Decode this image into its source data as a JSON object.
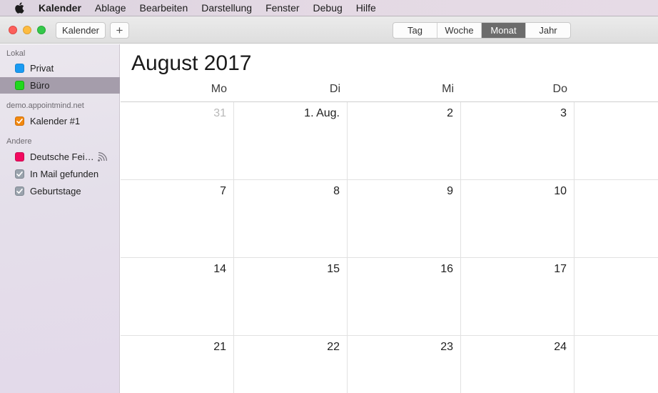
{
  "menubar": {
    "app": "Kalender",
    "items": [
      "Ablage",
      "Bearbeiten",
      "Darstellung",
      "Fenster",
      "Debug",
      "Hilfe"
    ]
  },
  "toolbar": {
    "kalender_label": "Kalender",
    "add_label": "+",
    "views": [
      "Tag",
      "Woche",
      "Monat",
      "Jahr"
    ],
    "active_view": "Monat"
  },
  "sidebar": {
    "groups": [
      {
        "label": "Lokal",
        "items": [
          {
            "name": "Privat",
            "color": "#1a9bf2",
            "checked": false,
            "selected": false
          },
          {
            "name": "Büro",
            "color": "#21d81d",
            "checked": false,
            "selected": true
          }
        ]
      },
      {
        "label": "demo.appointmind.net",
        "items": [
          {
            "name": "Kalender #1",
            "color": "#f2890f",
            "checked": true,
            "selected": false
          }
        ]
      },
      {
        "label": "Andere",
        "items": [
          {
            "name": "Deutsche Fei…",
            "color": "#f2095f",
            "checked": false,
            "selected": false,
            "icon": "subscription-feed-icon"
          },
          {
            "name": "In Mail gefunden",
            "color": "#9aa3ad",
            "checked": true,
            "selected": false
          },
          {
            "name": "Geburtstage",
            "color": "#9aa3ad",
            "checked": true,
            "selected": false
          }
        ]
      }
    ]
  },
  "calendar": {
    "title_month": "August",
    "title_year": "2017",
    "weekdays": [
      "Mo",
      "Di",
      "Mi",
      "Do"
    ],
    "weeks": [
      [
        {
          "label": "31",
          "muted": true
        },
        {
          "label": "1. Aug.",
          "muted": false
        },
        {
          "label": "2",
          "muted": false
        },
        {
          "label": "3",
          "muted": false
        }
      ],
      [
        {
          "label": "7",
          "muted": false
        },
        {
          "label": "8",
          "muted": false
        },
        {
          "label": "9",
          "muted": false
        },
        {
          "label": "10",
          "muted": false
        }
      ],
      [
        {
          "label": "14",
          "muted": false
        },
        {
          "label": "15",
          "muted": false
        },
        {
          "label": "16",
          "muted": false
        },
        {
          "label": "17",
          "muted": false
        }
      ],
      [
        {
          "label": "21",
          "muted": false
        },
        {
          "label": "22",
          "muted": false
        },
        {
          "label": "23",
          "muted": false
        },
        {
          "label": "24",
          "muted": false
        }
      ]
    ]
  }
}
